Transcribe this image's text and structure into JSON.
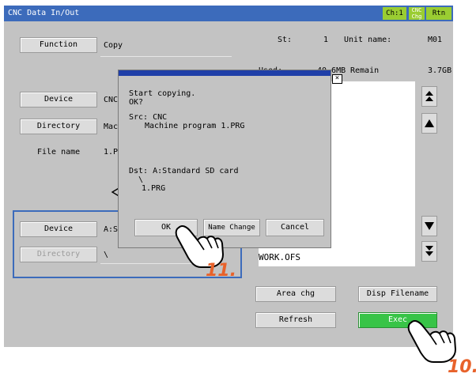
{
  "window": {
    "title": "CNC Data In/Out",
    "ch_label": "Ch:1",
    "cnc_chg_label": "CNC Chg",
    "rtn_label": "Rtn",
    "accent": "#3c6bbb",
    "button_green": "#9acd32"
  },
  "left_panel": {
    "function_button": "Function",
    "function_value": "Copy",
    "device_button": "Device",
    "device_value": "CNC",
    "directory_button": "Directory",
    "directory_value": "Mach",
    "file_name_label": "File name",
    "file_name_value": "1.PR",
    "dest_device_button": "Device",
    "dest_device_value": "A:St",
    "dest_directory_button": "Directory",
    "dest_directory_value": "\\"
  },
  "status": {
    "st_label": "St:",
    "st_value": "1",
    "unit_label": "Unit name:",
    "unit_value": "M01",
    "used_label": "Used:",
    "used_value": "40.6MB",
    "remain_label": "Remain",
    "remain_value": "3.7GB"
  },
  "file_list": {
    "visible_item": "WORK.OFS"
  },
  "right_buttons": {
    "area_chg": "Area chg",
    "disp_filename": "Disp Filename",
    "refresh": "Refresh",
    "exec": "Exec"
  },
  "dialog": {
    "close_glyph": "×",
    "line1": "Start copying.",
    "line2": "OK?",
    "src_label": "Src: CNC",
    "src_path": "Machine program 1.PRG",
    "dst_label": "Dst: A:Standard SD card",
    "dst_sep": "\\",
    "dst_file": "1.PRG",
    "ok_button": "OK",
    "name_change_button": "Name Change",
    "cancel_button": "Cancel"
  },
  "steps": {
    "step_exec": "10.",
    "step_ok": "11."
  }
}
